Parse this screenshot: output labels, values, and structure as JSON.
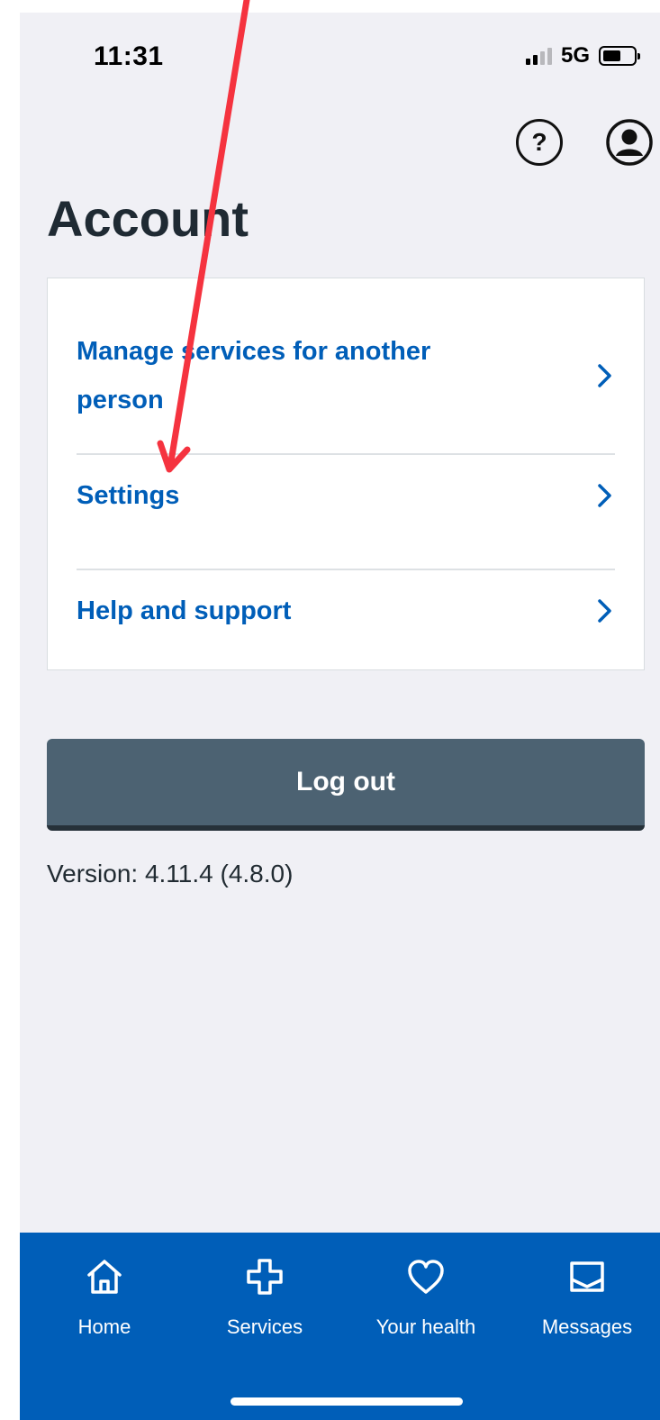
{
  "status_bar": {
    "time": "11:31",
    "network": "5G",
    "battery_level": 0.6
  },
  "top_actions": {
    "help_icon": "question-circle-icon",
    "profile_icon": "user-circle-icon"
  },
  "page": {
    "title": "Account"
  },
  "menu": {
    "items": [
      {
        "label": "Manage services for another person",
        "icon": "chevron-right-icon"
      },
      {
        "label": "Settings",
        "icon": "chevron-right-icon"
      },
      {
        "label": "Help and support",
        "icon": "chevron-right-icon"
      }
    ]
  },
  "logout": {
    "label": "Log out"
  },
  "version": {
    "text": "Version: 4.11.4 (4.8.0)"
  },
  "tab_bar": {
    "tabs": [
      {
        "label": "Home",
        "icon": "home-icon"
      },
      {
        "label": "Services",
        "icon": "plus-cross-icon"
      },
      {
        "label": "Your health",
        "icon": "heart-icon"
      },
      {
        "label": "Messages",
        "icon": "inbox-icon"
      }
    ]
  },
  "annotation": {
    "color": "#f5333f",
    "icon": "red-arrow-annotation"
  },
  "colors": {
    "brand_blue": "#005eb8",
    "background": "#f0f0f5",
    "logout_button": "#4c6272",
    "text_dark": "#1f2a33"
  }
}
